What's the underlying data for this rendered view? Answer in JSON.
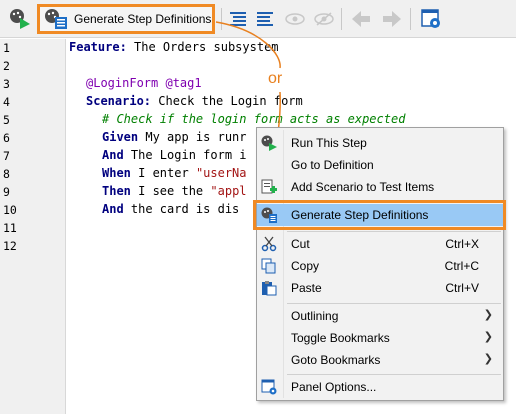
{
  "toolbar": {
    "generate_label": "Generate Step Definitions",
    "icons": [
      "run-step-icon",
      "generate-steps-icon",
      "align-left-icon",
      "align-right-icon",
      "eye-icon",
      "eye-disabled-icon",
      "back-arrow-icon",
      "forward-arrow-icon",
      "panel-options-icon"
    ]
  },
  "editor": {
    "line_numbers": [
      "1",
      "2",
      "3",
      "4",
      "5",
      "6",
      "7",
      "8",
      "9",
      "10",
      "11",
      "12"
    ],
    "lines": {
      "l1_kw": "Feature:",
      "l1_text": " The Orders subsystem",
      "l3_tags": "@LoginForm @tag1",
      "l4_kw": "Scenario:",
      "l4_text": " Check the Login form",
      "l5_comment": "# Check if the login form acts as expected",
      "l6_kw": "Given",
      "l6_text": " My app is runr",
      "l7_kw": "And",
      "l7_text": " The Login form i",
      "l8_kw": "When",
      "l8_text": " I enter ",
      "l8_str": "\"userNa",
      "l9_kw": "Then",
      "l9_text": " I see the ",
      "l9_str": "\"appl",
      "l10_kw": "And",
      "l10_text": " the card is dis"
    }
  },
  "annotation": {
    "or_text": "or"
  },
  "context_menu": {
    "items": {
      "run_step": {
        "label": "Run This Step",
        "mnemonic": "R",
        "rest": "un This Step"
      },
      "goto_def": {
        "label": "Go to Definition"
      },
      "add_scenario": {
        "label": "Add Scenario to Test Items"
      },
      "generate": {
        "label": "Generate Step Definitions"
      },
      "cut": {
        "label": "Cut",
        "shortcut": "Ctrl+X"
      },
      "copy": {
        "label": "Copy",
        "shortcut": "Ctrl+C"
      },
      "paste": {
        "label": "Paste",
        "shortcut": "Ctrl+V"
      },
      "outlining": {
        "label": "Outlining"
      },
      "toggle_bookmarks": {
        "label": "Toggle Bookmarks"
      },
      "goto_bookmarks": {
        "label": "Goto Bookmarks"
      },
      "panel_options": {
        "label": "Panel Options..."
      }
    }
  },
  "colors": {
    "highlight_border": "#f08a24",
    "menu_highlight": "#99c9f5",
    "keyword": "#00007f",
    "comment": "#008000",
    "tag": "#7f00b0",
    "string": "#a31515"
  }
}
